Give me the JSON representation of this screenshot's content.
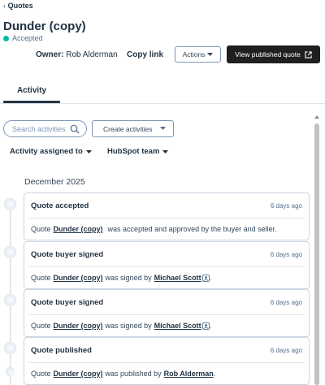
{
  "breadcrumb": {
    "back_label": "Quotes"
  },
  "header": {
    "title": "Dunder (copy)",
    "status": "Accepted",
    "owner_label": "Owner:",
    "owner_name": "Rob Alderman",
    "copy_link": "Copy link",
    "actions_label": "Actions",
    "view_published_label": "View published quote"
  },
  "tabs": [
    {
      "label": "Activity"
    }
  ],
  "toolbar": {
    "search_placeholder": "Search activities",
    "create_label": "Create activities"
  },
  "filters": {
    "assigned": "Activity assigned to",
    "team": "HubSpot team"
  },
  "timeline": {
    "month": "December 2025",
    "items": [
      {
        "title": "Quote accepted",
        "time": "6 days ago",
        "pre": "Quote",
        "link": "Dunder (copy)",
        "post": "was accepted and approved by the buyer and seller."
      },
      {
        "title": "Quote buyer signed",
        "time": "6 days ago",
        "pre": "Quote",
        "link": "Dunder (copy)",
        "mid": "was signed by",
        "person": "Michael Scott",
        "post": "."
      },
      {
        "title": "Quote buyer signed",
        "time": "6 days ago",
        "pre": "Quote",
        "link": "Dunder (copy)",
        "mid": "was signed by",
        "person": "Michael Scott",
        "post": "."
      },
      {
        "title": "Quote published",
        "time": "6 days ago",
        "pre": "Quote",
        "link": "Dunder (copy)",
        "mid": "was published by",
        "person": "Rob Alderman",
        "post": "."
      }
    ]
  },
  "colors": {
    "status_dot": "#00bda5",
    "primary_dark": "#1f1f1f",
    "link": "#213343",
    "border": "#cbd6e2"
  },
  "icons": [
    "chevron-left-icon",
    "search-icon",
    "caret-down-icon",
    "external-link-icon",
    "contact-card-icon"
  ]
}
